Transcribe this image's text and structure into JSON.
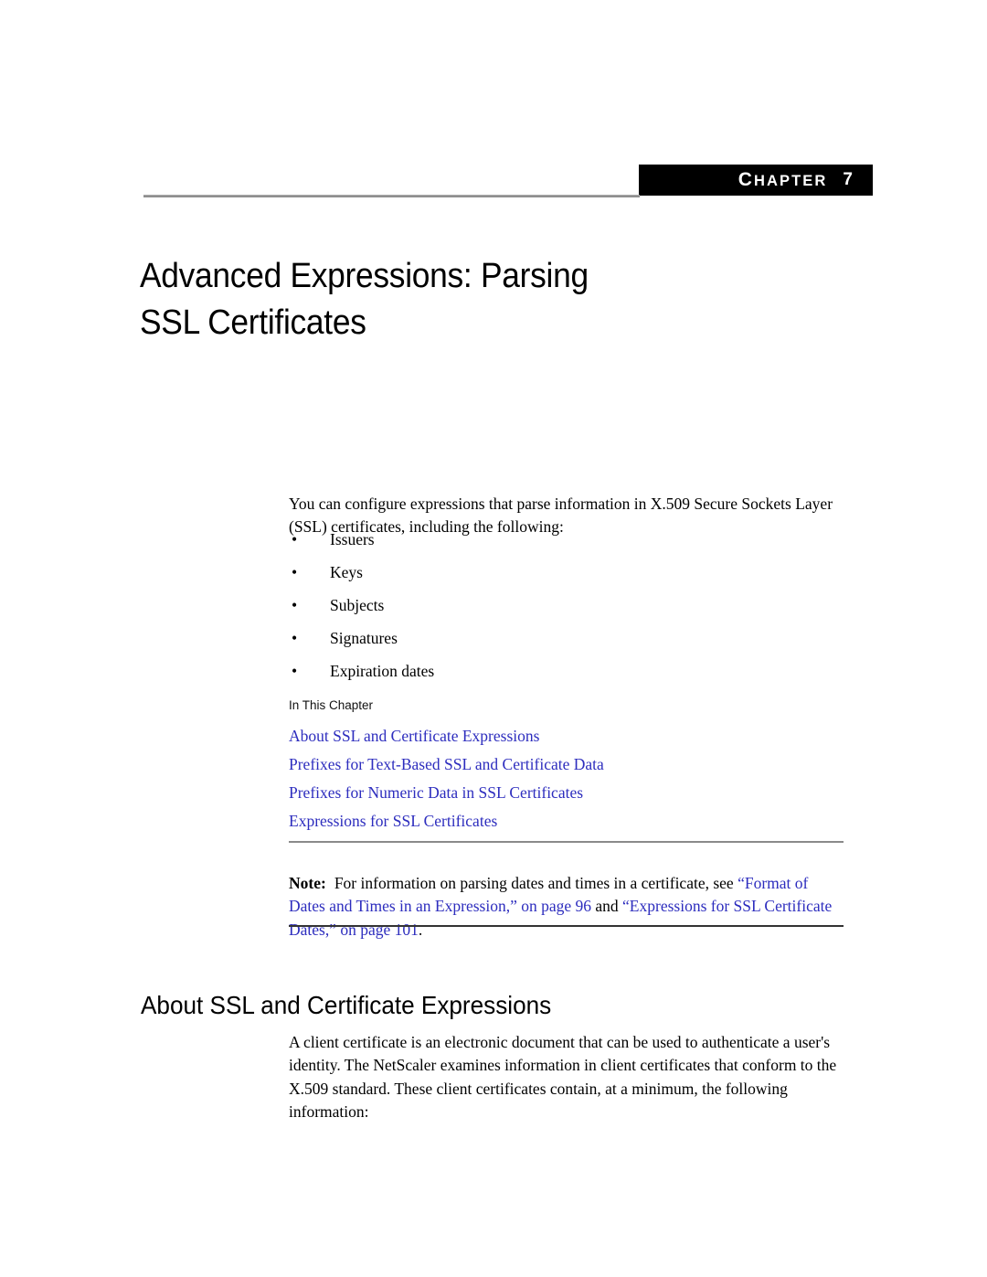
{
  "banner": {
    "chapter_word": "Chapter",
    "chapter_number": "7"
  },
  "chapter_title": {
    "line1": "Advanced Expressions: Parsing",
    "line2": "SSL Certificates"
  },
  "intro": {
    "paragraph": "You can configure expressions that parse information in X.509 Secure Sockets Layer (SSL) certificates, including the following:"
  },
  "bullets": [
    {
      "marker": "•",
      "text": "Issuers"
    },
    {
      "marker": "•",
      "text": "Keys"
    },
    {
      "marker": "•",
      "text": "Subjects"
    },
    {
      "marker": "•",
      "text": "Signatures"
    },
    {
      "marker": "•",
      "text": "Expiration dates"
    }
  ],
  "in_this_chapter": {
    "label": "In This Chapter",
    "links": [
      "About SSL and Certificate Expressions",
      "Prefixes for Text-Based SSL and Certificate Data",
      "Prefixes for Numeric Data in SSL Certificates",
      "Expressions for SSL Certificates"
    ]
  },
  "note": {
    "label": "Note:",
    "text_before": "For information on parsing dates and times in a certificate, see ",
    "link1": "“Format of Dates and Times in an Expression,” on page 96",
    "conjunction": " and ",
    "link2": "“Expressions for SSL Certificate Dates,” on page 101",
    "trailing": "."
  },
  "section": {
    "heading": "About SSL and Certificate Expressions",
    "paragraph": "A client certificate is an electronic document that can be used to authenticate a user's identity. The NetScaler examines information in client certificates that conform to the X.509 standard. These client certificates contain, at a minimum, the following information:"
  },
  "colors": {
    "link_blue": "#2d2dbe",
    "banner_background": "#000000",
    "banner_text": "#ffffff",
    "rule_gray": "#8a8a8a",
    "rule_dark": "#333333",
    "body_text": "#000000"
  }
}
